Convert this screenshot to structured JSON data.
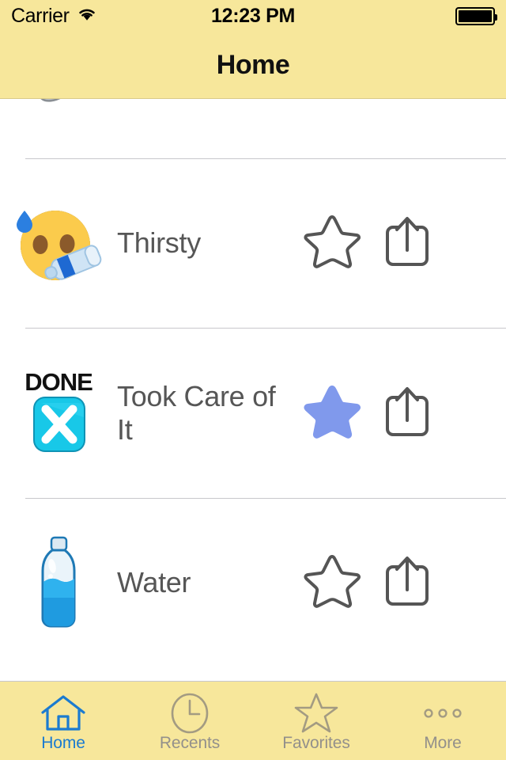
{
  "status_bar": {
    "carrier": "Carrier",
    "wifi_icon": "wifi-icon",
    "time": "12:23 PM",
    "battery_icon": "battery-full-icon"
  },
  "nav_bar": {
    "title": "Home"
  },
  "theme": {
    "bar_background": "#F7E79B",
    "active_tab_color": "#1B7BD0",
    "inactive_tab_color": "#93908B",
    "filled_star_color": "#8099EC",
    "outline_star_color": "#555555",
    "separator_color": "#C8C7CC",
    "row_label_color": "#565656"
  },
  "list": {
    "rows": [
      {
        "label": "",
        "emoji_name": "faucet-emoji",
        "favorited": false,
        "partial": true
      },
      {
        "label": "Thirsty",
        "emoji_name": "hot-face-drinking-emoji",
        "favorited": false,
        "star_icon": "star-outline-icon",
        "share_icon": "share-icon"
      },
      {
        "label": "Took Care of It",
        "emoji_name": "done-cross-mark-button-emoji",
        "favorited": true,
        "star_icon": "star-filled-icon",
        "share_icon": "share-icon"
      },
      {
        "label": "Water",
        "emoji_name": "water-bottle-emoji",
        "favorited": false,
        "star_icon": "star-outline-icon",
        "share_icon": "share-icon"
      }
    ]
  },
  "tab_bar": {
    "items": [
      {
        "label": "Home",
        "icon": "house-icon",
        "active": true
      },
      {
        "label": "Recents",
        "icon": "clock-icon",
        "active": false
      },
      {
        "label": "Favorites",
        "icon": "star-icon",
        "active": false
      },
      {
        "label": "More",
        "icon": "ellipsis-icon",
        "active": false
      }
    ]
  }
}
